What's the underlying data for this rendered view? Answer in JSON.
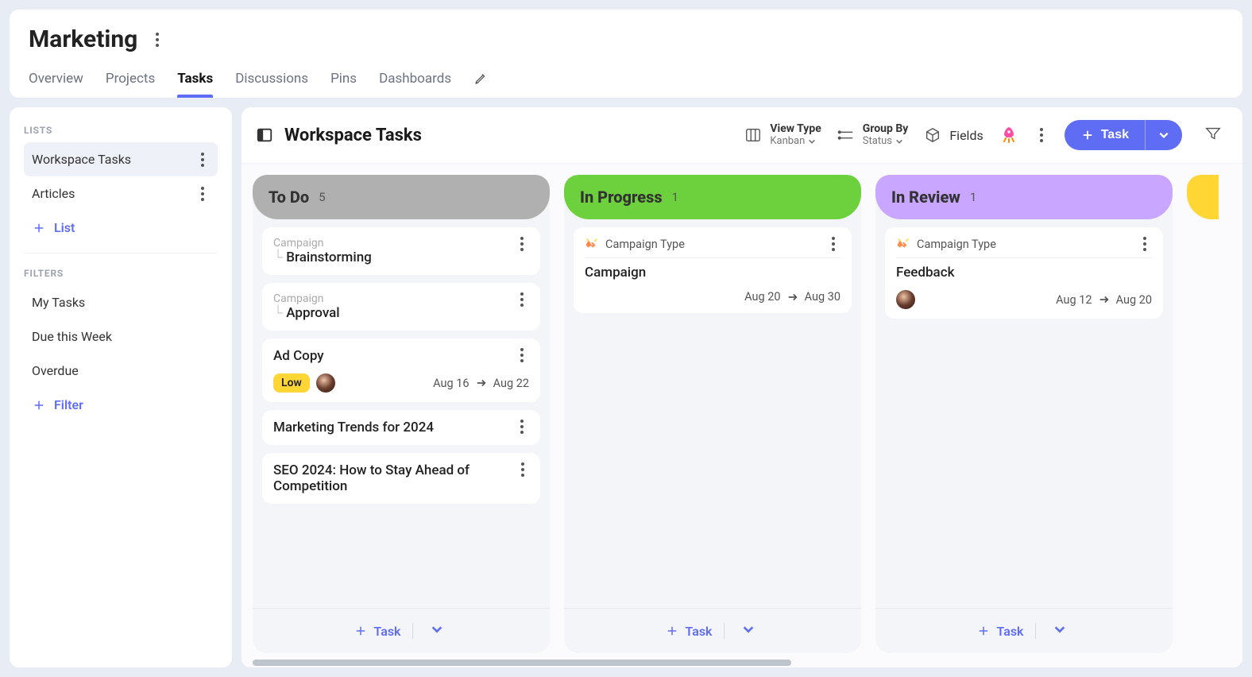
{
  "pageTitle": "Marketing",
  "tabs": [
    "Overview",
    "Projects",
    "Tasks",
    "Discussions",
    "Pins",
    "Dashboards"
  ],
  "activeTab": "Tasks",
  "sidebar": {
    "listsHeading": "LISTS",
    "filtersHeading": "FILTERS",
    "lists": [
      {
        "label": "Workspace Tasks",
        "selected": true
      },
      {
        "label": "Articles",
        "selected": false
      }
    ],
    "addListLabel": "List",
    "filters": [
      {
        "label": "My Tasks"
      },
      {
        "label": "Due this Week"
      },
      {
        "label": "Overdue"
      }
    ],
    "addFilterLabel": "Filter"
  },
  "toolbar": {
    "boardTitle": "Workspace Tasks",
    "viewType": {
      "label": "View Type",
      "value": "Kanban"
    },
    "groupBy": {
      "label": "Group By",
      "value": "Status"
    },
    "fieldsLabel": "Fields",
    "taskButton": "Task"
  },
  "columns": [
    {
      "key": "todo",
      "title": "To Do",
      "count": 5,
      "headerClass": "todo",
      "cards": [
        {
          "breadcrumb": "Campaign",
          "subtask": true,
          "title": "Brainstorming"
        },
        {
          "breadcrumb": "Campaign",
          "subtask": true,
          "title": "Approval"
        },
        {
          "title": "Ad Copy",
          "priority": "Low",
          "avatar": true,
          "startDate": "Aug 16",
          "endDate": "Aug 22"
        },
        {
          "title": "Marketing Trends for 2024"
        },
        {
          "title": "SEO 2024: How to Stay Ahead of Competition"
        }
      ]
    },
    {
      "key": "in-progress",
      "title": "In Progress",
      "count": 1,
      "headerClass": "in-progress",
      "cards": [
        {
          "tag": "Campaign Type",
          "title": "Campaign",
          "startDate": "Aug 20",
          "endDate": "Aug 30"
        }
      ]
    },
    {
      "key": "in-review",
      "title": "In Review",
      "count": 1,
      "headerClass": "in-review",
      "cards": [
        {
          "tag": "Campaign Type",
          "title": "Feedback",
          "avatar": true,
          "startDate": "Aug 12",
          "endDate": "Aug 20"
        }
      ]
    }
  ],
  "columnFooterTaskLabel": "Task",
  "peekColumnHeaderClass": "yellow"
}
